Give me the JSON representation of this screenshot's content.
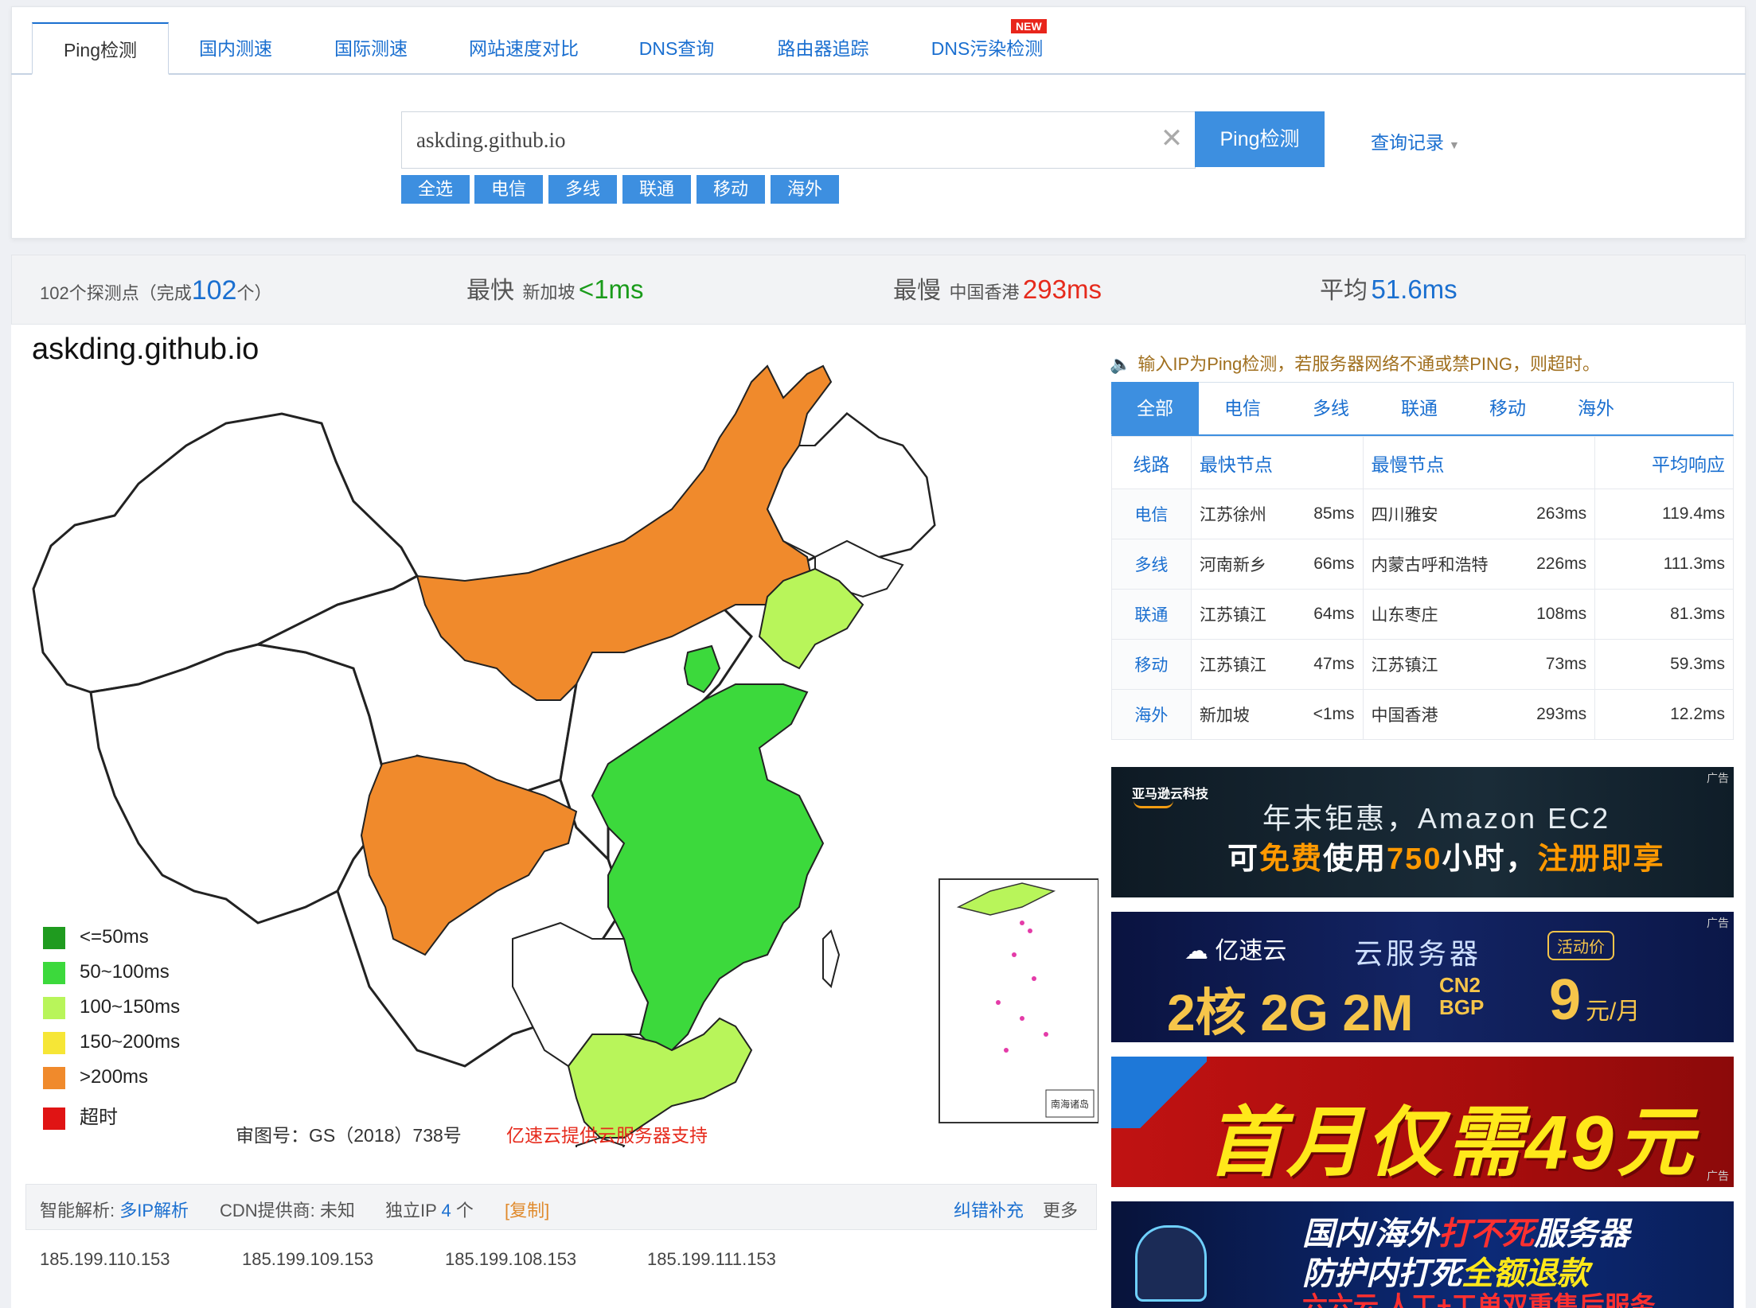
{
  "tabs": [
    {
      "label": "Ping检测",
      "active": true
    },
    {
      "label": "国内测速"
    },
    {
      "label": "国际测速"
    },
    {
      "label": "网站速度对比"
    },
    {
      "label": "DNS查询"
    },
    {
      "label": "路由器追踪"
    },
    {
      "label": "DNS污染检测",
      "badge": "NEW"
    }
  ],
  "search": {
    "value": "askding.github.io",
    "button": "Ping检测",
    "clear_icon": "close-icon",
    "history": "查询记录"
  },
  "filters": [
    "全选",
    "电信",
    "多线",
    "联通",
    "移动",
    "海外"
  ],
  "stats": {
    "probes_text": "102个探测点（完成",
    "probes_done": "102",
    "probes_suffix": "个）",
    "fastest_label": "最快",
    "fastest_loc": "新加坡",
    "fastest_val": "<1ms",
    "slowest_label": "最慢",
    "slowest_loc": "中国香港",
    "slowest_val": "293ms",
    "avg_label": "平均",
    "avg_val": "51.6ms"
  },
  "map": {
    "title": "askding.github.io",
    "legend": [
      {
        "label": "<=50ms",
        "color": "#1f9b1f"
      },
      {
        "label": "50~100ms",
        "color": "#3cd93c"
      },
      {
        "label": "100~150ms",
        "color": "#b8f55a"
      },
      {
        "label": "150~200ms",
        "color": "#f6e636"
      },
      {
        "label": ">200ms",
        "color": "#f08a2c"
      },
      {
        "label": "超时",
        "color": "#e01414"
      }
    ],
    "credit": "审图号：GS（2018）738号",
    "sponsor": "亿速云提供云服务器支持",
    "inset_label": "南海诸岛"
  },
  "notice": "输入IP为Ping检测，若服务器网络不通或禁PING，则超时。",
  "isp_tabs": [
    "全部",
    "电信",
    "多线",
    "联通",
    "移动",
    "海外"
  ],
  "table": {
    "headers": [
      "线路",
      "最快节点",
      "最慢节点",
      "平均响应"
    ],
    "rows": [
      {
        "line": "电信",
        "fast_city": "江苏徐州",
        "fast_ms": "85ms",
        "slow_city": "四川雅安",
        "slow_ms": "263ms",
        "avg": "119.4ms"
      },
      {
        "line": "多线",
        "fast_city": "河南新乡",
        "fast_ms": "66ms",
        "slow_city": "内蒙古呼和浩特",
        "slow_ms": "226ms",
        "avg": "111.3ms"
      },
      {
        "line": "联通",
        "fast_city": "江苏镇江",
        "fast_ms": "64ms",
        "slow_city": "山东枣庄",
        "slow_ms": "108ms",
        "avg": "81.3ms"
      },
      {
        "line": "移动",
        "fast_city": "江苏镇江",
        "fast_ms": "47ms",
        "slow_city": "江苏镇江",
        "slow_ms": "73ms",
        "avg": "59.3ms"
      },
      {
        "line": "海外",
        "fast_city": "新加坡",
        "fast_ms": "<1ms",
        "slow_city": "中国香港",
        "slow_ms": "293ms",
        "avg": "12.2ms"
      }
    ]
  },
  "ads": {
    "tag": "广告",
    "ad1": {
      "brand": "亚马逊云科技",
      "line1": "年末钜惠，Amazon EC2",
      "line2a": "可",
      "line2b": "免费",
      "line2c": "使用",
      "line2d": "750",
      "line2e": "小时，",
      "line2f": "注册即享"
    },
    "ad2": {
      "brand": "亿速云",
      "product": "云服务器",
      "badge": "活动价",
      "spec": "2核 2G 2M",
      "net1": "CN2",
      "net2": "BGP",
      "price": "9",
      "unit": "元/月"
    },
    "ad3": {
      "text": "首月仅需49元"
    },
    "ad4": {
      "line1a": "国内/海外",
      "line1b": "打不死",
      "line1c": "服务器",
      "line2a": "防护内打死",
      "line2b": "全额退款",
      "line3": "六六云 人工+工单双重售后服务"
    }
  },
  "info": {
    "resolve_label": "智能解析:",
    "resolve_link": "多IP解析",
    "cdn": "CDN提供商: 未知",
    "ip_label": "独立IP",
    "ip_count": "4",
    "ip_unit": "个",
    "copy": "[复制]",
    "report": "纠错补充",
    "more": "更多",
    "ips": [
      "185.199.110.153",
      "185.199.109.153",
      "185.199.108.153",
      "185.199.111.153"
    ]
  },
  "colors": {
    "accent": "#3d8fe0",
    "link": "#1a6fd0",
    "fast": "#1a9b1a",
    "slow": "#e62a1c"
  }
}
